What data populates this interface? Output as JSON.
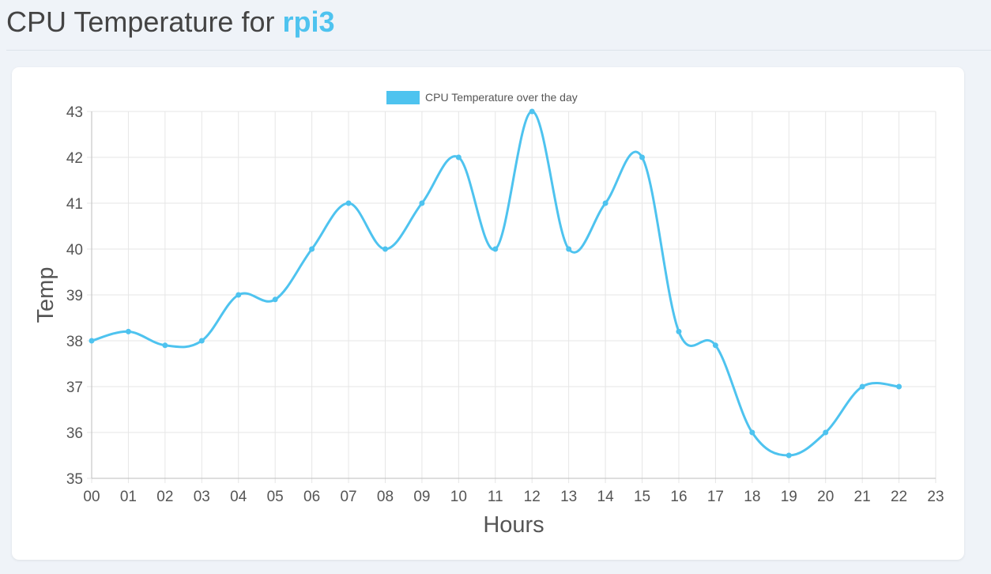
{
  "header": {
    "title_prefix": "CPU Temperature for",
    "host": "rpi3"
  },
  "colors": {
    "accent": "#4ec3ef",
    "grid": "#e6e6e6",
    "text": "#555555"
  },
  "chart_data": {
    "type": "line",
    "legend": "CPU Temperature over the day",
    "legend_position": "top-center",
    "xlabel": "Hours",
    "ylabel": "Temp",
    "categories": [
      "00",
      "01",
      "02",
      "03",
      "04",
      "05",
      "06",
      "07",
      "08",
      "09",
      "10",
      "11",
      "12",
      "13",
      "14",
      "15",
      "16",
      "17",
      "18",
      "19",
      "20",
      "21",
      "22",
      "23"
    ],
    "series": [
      {
        "name": "CPU Temperature over the day",
        "values": [
          38,
          38.2,
          37.9,
          38,
          39,
          38.9,
          40,
          41,
          40,
          41,
          42,
          40,
          43,
          40,
          41,
          42,
          38.2,
          37.9,
          36,
          35.5,
          36,
          37,
          37,
          null
        ]
      }
    ],
    "ylim": [
      35,
      43
    ],
    "yticks": [
      "35",
      "36",
      "37",
      "38",
      "39",
      "40",
      "41",
      "42",
      "43"
    ],
    "grid": true,
    "smooth": true
  }
}
